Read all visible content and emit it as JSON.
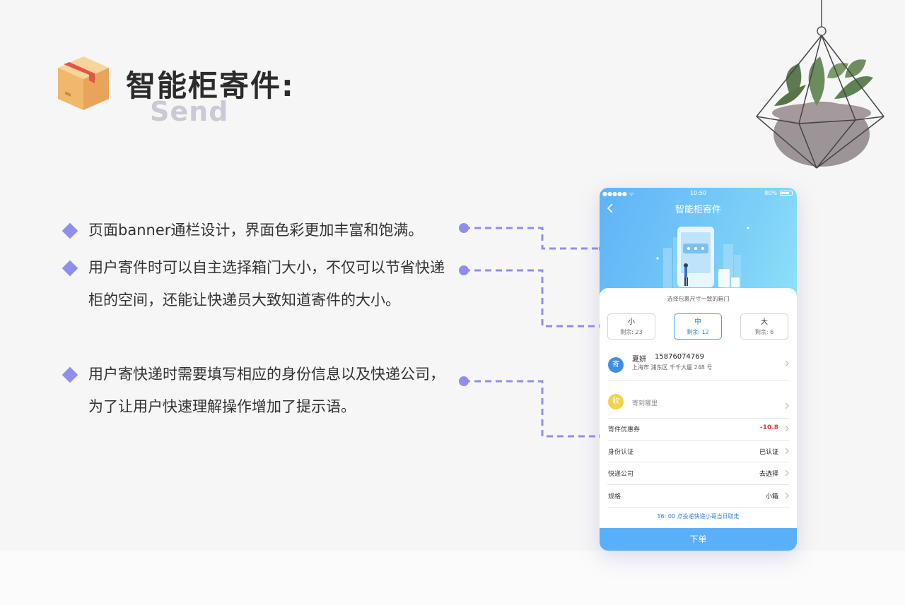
{
  "header": {
    "title": "智能柜寄件:",
    "subtitle": "Send"
  },
  "bullets": [
    "页面banner通栏设计，界面色彩更加丰富和饱满。",
    "用户寄件时可以自主选择箱门大小，不仅可以节省快递柜的空间，还能让快递员大致知道寄件的大小。",
    "用户寄快递时需要填写相应的身份信息以及快递公司，为了让用户快速理解操作增加了提示语。"
  ],
  "phone": {
    "status": {
      "time": "10:50",
      "battery": "80%"
    },
    "title": "智能柜寄件",
    "size_hint": "选择包裹尺寸一致的箱门",
    "sizes": [
      {
        "label": "小",
        "remain": "剩余: 23"
      },
      {
        "label": "中",
        "remain": "剩余: 12"
      },
      {
        "label": "大",
        "remain": "剩余: 6"
      }
    ],
    "sender": {
      "badge": "寄",
      "name": "夏妍",
      "phone": "15876074769",
      "address": "上海市 浦东区 千千大厦 248 号"
    },
    "receiver": {
      "badge": "收",
      "placeholder": "寄到哪里"
    },
    "rows": [
      {
        "label": "寄件优惠券",
        "value": "-10.8"
      },
      {
        "label": "身份认证",
        "value": "已认证"
      },
      {
        "label": "快递公司",
        "value": "去选择"
      },
      {
        "label": "规格",
        "value": "小箱"
      }
    ],
    "notice": "16: 00 点投递快递小哥当日取走",
    "order_button": "下单"
  },
  "colors": {
    "accent": "#8f8ef0",
    "banner": "#6cc2f7",
    "primary": "#5ab0f8",
    "sender_badge": "#3e8fe6",
    "receiver_badge": "#f1d24a",
    "coupon": "#e33333"
  }
}
